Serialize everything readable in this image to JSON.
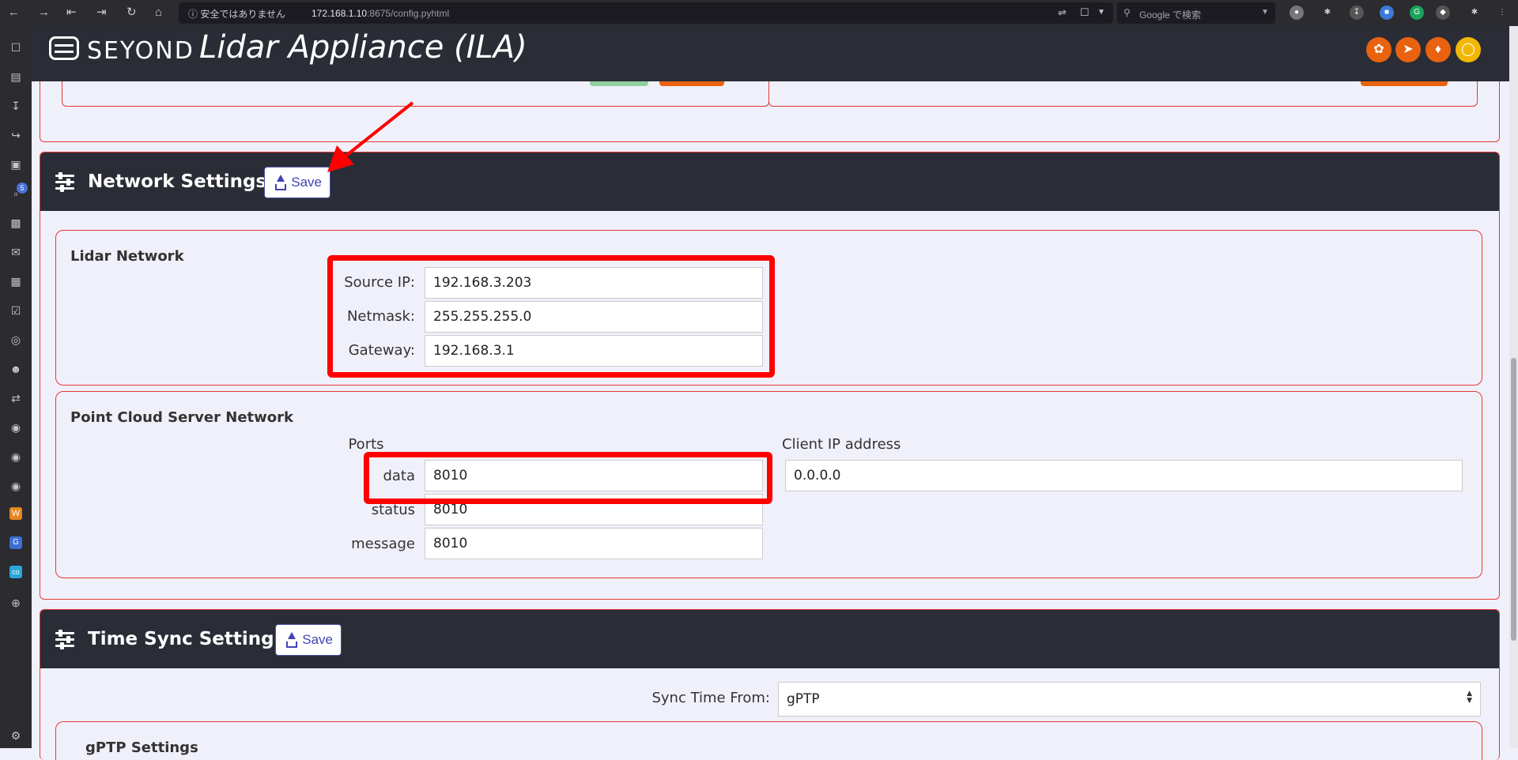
{
  "browser": {
    "security_text": "安全ではありません",
    "url_host": "172.168.1.10",
    "url_path": ":8675/config.pyhtml",
    "search_placeholder": "Google で検索",
    "sidebar_badge": "5"
  },
  "header": {
    "brand": "SEYOND",
    "title": "Lidar Appliance (ILA)"
  },
  "network_settings": {
    "title": "Network Settings",
    "save_label": "Save",
    "lidar_network": {
      "title": "Lidar Network",
      "source_ip_label": "Source IP:",
      "source_ip": "192.168.3.203",
      "netmask_label": "Netmask:",
      "netmask": "255.255.255.0",
      "gateway_label": "Gateway:",
      "gateway": "192.168.3.1"
    },
    "point_cloud": {
      "title": "Point Cloud Server Network",
      "ports_label": "Ports",
      "client_ip_label": "Client IP address",
      "client_ip": "0.0.0.0",
      "data_label": "data",
      "data_port": "8010",
      "status_label": "status",
      "status_port": "8010",
      "message_label": "message",
      "message_port": "8010"
    }
  },
  "time_sync": {
    "title": "Time Sync Settings",
    "save_label": "Save",
    "sync_from_label": "Sync Time From:",
    "sync_from_value": "gPTP",
    "gptp_title": "gPTP Settings"
  },
  "colors": {
    "header_bg": "#2a2d36",
    "panel_border": "#e53935",
    "highlight": "#ff0000",
    "accent_orange": "#e8620f",
    "accent_yellow": "#f2b705"
  }
}
